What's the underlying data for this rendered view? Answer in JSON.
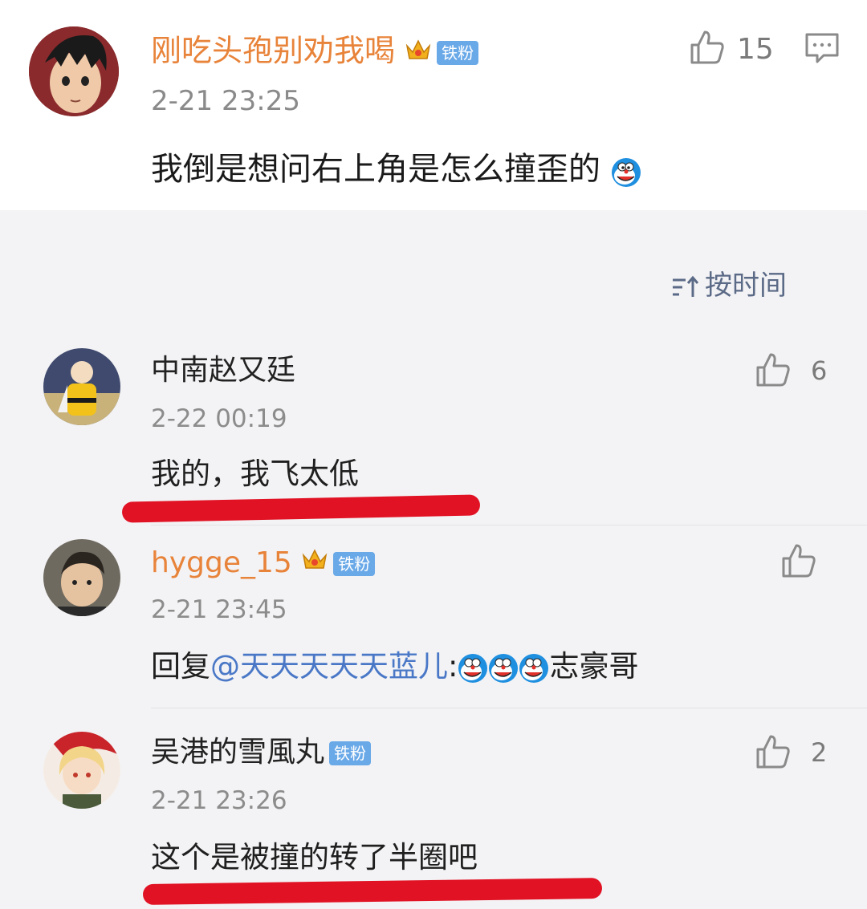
{
  "main_comment": {
    "username": "刚吃头孢别劝我喝",
    "badge": "铁粉",
    "timestamp": "2-21 23:25",
    "text": "我倒是想问右上角是怎么撞歪的",
    "like_count": "15",
    "icons": [
      "thumbs-up-icon",
      "comment-icon",
      "doraemon-emoji-icon",
      "crown-icon"
    ]
  },
  "sort": {
    "label": "按时间",
    "icon": "sort-icon"
  },
  "replies": [
    {
      "username": "中南赵又廷",
      "timestamp": "2-22 00:19",
      "text": "我的，我飞太低",
      "like_count": "6"
    },
    {
      "username": "hygge_15",
      "badge": "铁粉",
      "timestamp": "2-21 23:45",
      "text_prefix": "回复",
      "mention": "@天天天天天蓝儿",
      "text_colon": ":",
      "text_suffix": "志豪哥"
    },
    {
      "username": "吴港的雪風丸",
      "badge": "铁粉",
      "timestamp": "2-21 23:26",
      "text": "这个是被撞的转了半圈吧",
      "like_count": "2"
    }
  ],
  "colors": {
    "highlight_underline": "#e11224",
    "mention_blue": "#4a78c7",
    "username_orange": "#e8833a",
    "badge_blue": "#6aa9e8"
  }
}
